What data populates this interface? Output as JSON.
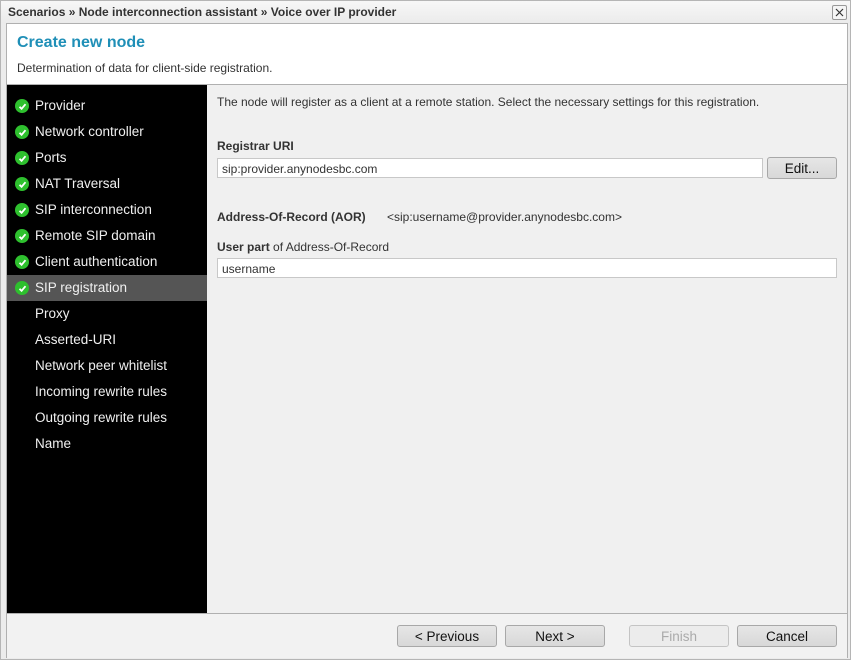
{
  "titlebar": {
    "breadcrumb": "Scenarios » Node interconnection assistant » Voice over IP provider",
    "close_icon": "close-icon"
  },
  "header": {
    "title": "Create new node",
    "subtitle": "Determination of data for client-side registration."
  },
  "sidebar": {
    "items": [
      {
        "label": "Provider",
        "done": true,
        "active": false
      },
      {
        "label": "Network controller",
        "done": true,
        "active": false
      },
      {
        "label": "Ports",
        "done": true,
        "active": false
      },
      {
        "label": "NAT Traversal",
        "done": true,
        "active": false
      },
      {
        "label": "SIP interconnection",
        "done": true,
        "active": false
      },
      {
        "label": "Remote SIP domain",
        "done": true,
        "active": false
      },
      {
        "label": "Client authentication",
        "done": true,
        "active": false
      },
      {
        "label": "SIP registration",
        "done": true,
        "active": true
      },
      {
        "label": "Proxy",
        "done": false,
        "active": false
      },
      {
        "label": "Asserted-URI",
        "done": false,
        "active": false
      },
      {
        "label": "Network peer whitelist",
        "done": false,
        "active": false
      },
      {
        "label": "Incoming rewrite rules",
        "done": false,
        "active": false
      },
      {
        "label": "Outgoing rewrite rules",
        "done": false,
        "active": false
      },
      {
        "label": "Name",
        "done": false,
        "active": false
      }
    ]
  },
  "content": {
    "intro": "The node will register as a client at a remote station. Select the necessary settings for this registration.",
    "registrar_uri": {
      "label": "Registrar URI",
      "value": "sip:provider.anynodesbc.com",
      "edit_label": "Edit..."
    },
    "aor": {
      "label": "Address-Of-Record (AOR)",
      "value": "<sip:username@provider.anynodesbc.com>"
    },
    "user_part": {
      "label_bold": "User part",
      "label_rest": " of Address-Of-Record",
      "value": "username"
    }
  },
  "footer": {
    "previous": "< Previous",
    "next": "Next >",
    "finish": "Finish",
    "cancel": "Cancel"
  },
  "colors": {
    "accent": "#1f8fb7",
    "check": "#2ec02e",
    "sidebar_bg": "#000000",
    "sidebar_active": "#555555"
  }
}
